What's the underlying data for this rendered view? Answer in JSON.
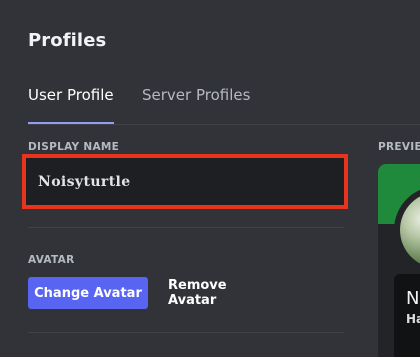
{
  "header": {
    "title": "Profiles"
  },
  "tabs": [
    {
      "label": "User Profile",
      "active": true
    },
    {
      "label": "Server Profiles",
      "active": false
    }
  ],
  "display_name": {
    "label": "DISPLAY NAME",
    "value": "Noisyturtle",
    "highlight_color": "#e8341c"
  },
  "preview": {
    "label": "PREVIEW",
    "name_partial": "N",
    "sub_partial": "Ha",
    "banner_color": "#1f8a3b"
  },
  "avatar": {
    "label": "AVATAR",
    "change_label": "Change Avatar",
    "remove_label": "Remove Avatar"
  },
  "colors": {
    "background": "#313338",
    "accent": "#5865f2",
    "tab_underline": "#949cf7",
    "input_background": "#1e1f22"
  }
}
